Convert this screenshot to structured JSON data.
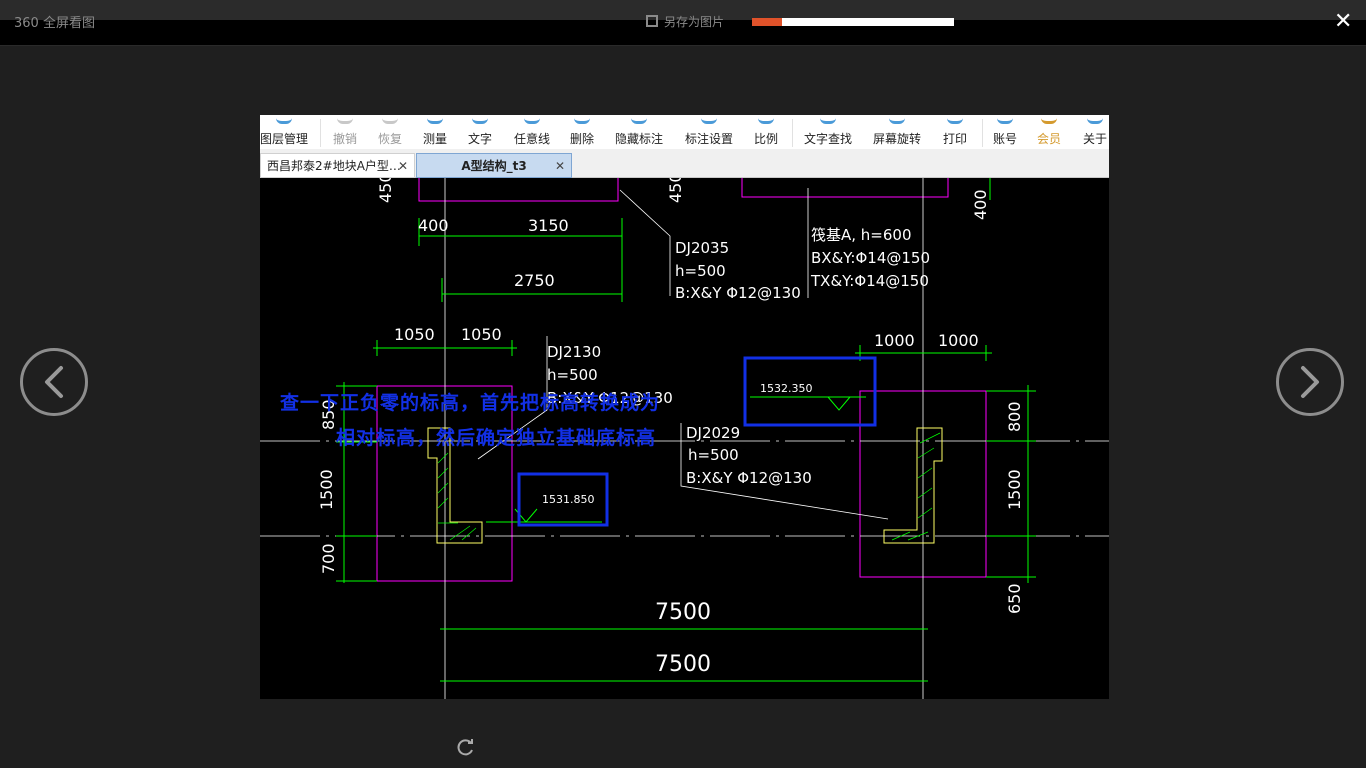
{
  "viewer": {
    "app_title": "360 全屏看图",
    "save_label": "另存为图片",
    "close_glyph": "✕",
    "prev_icon": "chevron-left-icon",
    "next_icon": "chevron-right-icon"
  },
  "toolbar": {
    "items": [
      {
        "label": "图层管理"
      },
      {
        "label": "撤销"
      },
      {
        "label": "恢复"
      },
      {
        "label": "测量"
      },
      {
        "label": "文字"
      },
      {
        "label": "任意线"
      },
      {
        "label": "删除"
      },
      {
        "label": "隐藏标注"
      },
      {
        "label": "标注设置"
      },
      {
        "label": "比例"
      },
      {
        "label": "文字查找"
      },
      {
        "label": "屏幕旋转"
      },
      {
        "label": "打印"
      },
      {
        "label": "账号"
      },
      {
        "label": "会员"
      },
      {
        "label": "关于"
      }
    ]
  },
  "tabs": [
    {
      "label": "西昌邦泰2#地块A户型…",
      "close": "✕"
    },
    {
      "label": "A型结构_t3",
      "close": "✕"
    }
  ],
  "drawing": {
    "dims": {
      "d450a": "450",
      "d450b": "450",
      "d400a": "400",
      "d3150": "3150",
      "d2750": "2750",
      "d400b": "400",
      "d1050a": "1050",
      "d1050b": "1050",
      "d1000a": "1000",
      "d1000b": "1000",
      "d850": "850",
      "d1500a": "1500",
      "d700": "700",
      "d800": "800",
      "d1500b": "1500",
      "d650": "650",
      "d7500a": "7500",
      "d7500b": "7500"
    },
    "labels": {
      "dj2035": "DJ2035",
      "dj2035_h": "h=500",
      "dj2035_b": "B:X&Y Φ12@130",
      "raft_a": "筏基A, h=600",
      "raft_bxy": "BX&Y:Φ14@150",
      "raft_txy": "TX&Y:Φ14@150",
      "dj2130": "DJ2130",
      "dj2130_h": "h=500",
      "dj2130_b": "B:X&Y Φ12@130",
      "dj2029": "DJ2029",
      "dj2029_h": "h=500",
      "dj2029_b": "B:X&Y Φ12@130",
      "elev1": "1532.350",
      "elev2": "1531.850"
    },
    "annotation_line1": "查一下正负零的标高，首先把标高转换成为",
    "annotation_line2": "相对标高，然后确定独立基础底标高"
  },
  "colors": {
    "dim_green": "#00ff00",
    "outline_magenta": "#ff00ff",
    "hatch_yellow": "#ffff66",
    "highlight_blue": "#1230e6"
  }
}
